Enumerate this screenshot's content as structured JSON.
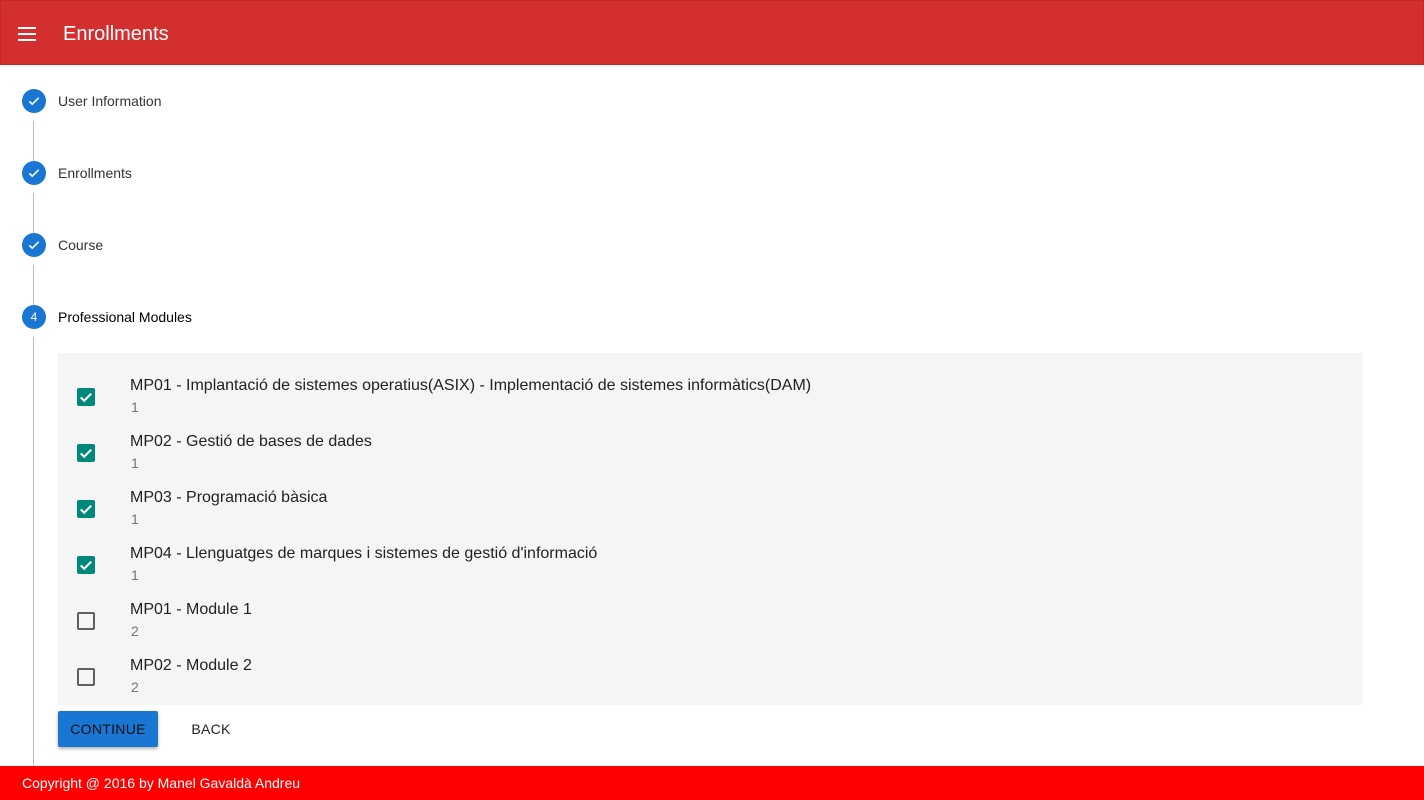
{
  "appbar": {
    "title": "Enrollments",
    "menu_icon": "menu-icon"
  },
  "stepper": {
    "steps": [
      {
        "label": "User Information",
        "status": "completed",
        "icon": "check-icon"
      },
      {
        "label": "Enrollments",
        "status": "completed",
        "icon": "check-icon"
      },
      {
        "label": "Course",
        "status": "completed",
        "icon": "check-icon"
      },
      {
        "label": "Professional Modules",
        "status": "active",
        "number": "4"
      }
    ]
  },
  "modules": [
    {
      "title": "MP01 - Implantació de sistemes operatius(ASIX) - Implementació de sistemes informàtics(DAM)",
      "subtitle": "1",
      "checked": true
    },
    {
      "title": "MP02 - Gestió de bases de dades",
      "subtitle": "1",
      "checked": true
    },
    {
      "title": "MP03 - Programació bàsica",
      "subtitle": "1",
      "checked": true
    },
    {
      "title": "MP04 - Llenguatges de marques i sistemes de gestió d'informació",
      "subtitle": "1",
      "checked": true
    },
    {
      "title": "MP01 - Module 1",
      "subtitle": "2",
      "checked": false
    },
    {
      "title": "MP02 - Module 2",
      "subtitle": "2",
      "checked": false
    }
  ],
  "actions": {
    "continue_label": "CONTINUE",
    "back_label": "BACK"
  },
  "footer": {
    "text": "Copyright @ 2016 by Manel Gavaldà Andreu"
  },
  "colors": {
    "appbar": "#d32f2f",
    "step_circle": "#1976d2",
    "checkbox_checked": "#00897b",
    "continue_button": "#1976d2",
    "footer": "#ff0000"
  }
}
